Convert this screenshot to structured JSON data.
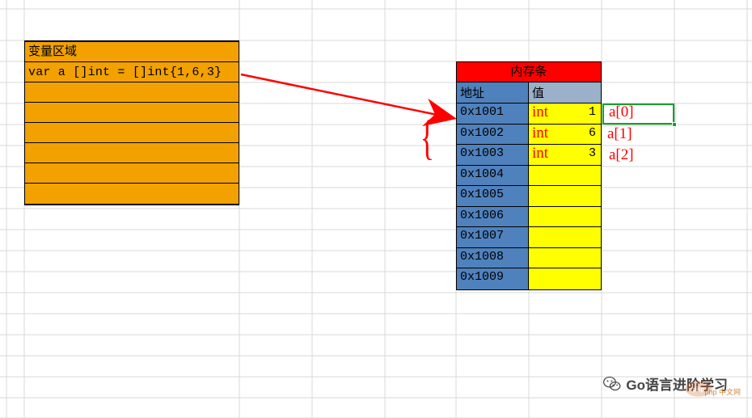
{
  "variable_box": {
    "title": "变量区域",
    "code": "var a []int = []int{1,6,3}"
  },
  "memory": {
    "title": "内存条",
    "header_addr": "地址",
    "header_val": "值",
    "rows": [
      {
        "addr": "0x1001",
        "val": "1",
        "type": "int"
      },
      {
        "addr": "0x1002",
        "val": "6",
        "type": "int"
      },
      {
        "addr": "0x1003",
        "val": "3",
        "type": "int"
      },
      {
        "addr": "0x1004",
        "val": "",
        "type": ""
      },
      {
        "addr": "0x1005",
        "val": "",
        "type": ""
      },
      {
        "addr": "0x1006",
        "val": "",
        "type": ""
      },
      {
        "addr": "0x1007",
        "val": "",
        "type": ""
      },
      {
        "addr": "0x1008",
        "val": "",
        "type": ""
      },
      {
        "addr": "0x1009",
        "val": "",
        "type": ""
      }
    ]
  },
  "index_labels": {
    "a0": "a[0]",
    "a1": "a[1]",
    "a2": "a[2]"
  },
  "footer": {
    "text": "Go语言进阶学习"
  },
  "watermark": {
    "text": "php 中文网"
  }
}
